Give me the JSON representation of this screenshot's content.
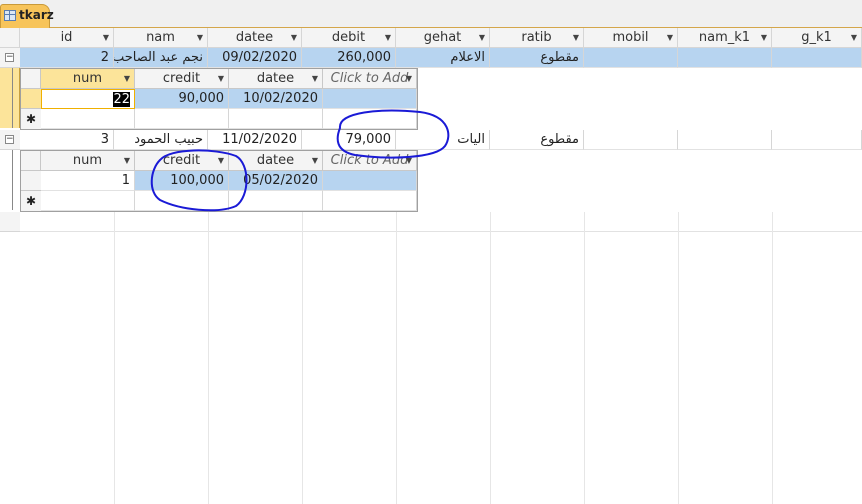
{
  "tab": {
    "label": "tkarz"
  },
  "columns": [
    "id",
    "nam",
    "datee",
    "debit",
    "gehat",
    "ratib",
    "mobil",
    "nam_k1",
    "g_k1"
  ],
  "records": [
    {
      "id": "2",
      "nam": "نجم عبد الصاحب",
      "datee": "09/02/2020",
      "debit": "260,000",
      "gehat": "الاعلام",
      "ratib": "مقطوع",
      "subform": {
        "headers": [
          "num",
          "credit",
          "datee",
          "Click to Add"
        ],
        "row": {
          "num": "22",
          "credit": "90,000",
          "datee": "10/02/2020"
        }
      }
    },
    {
      "id": "3",
      "nam": "حبيب الحمود",
      "datee": "11/02/2020",
      "debit": "79,000",
      "gehat": "اليات",
      "ratib": "مقطوع",
      "subform": {
        "headers": [
          "num",
          "credit",
          "datee",
          "Click to Add"
        ],
        "row": {
          "num": "1",
          "credit": "100,000",
          "datee": "05/02/2020"
        }
      }
    }
  ],
  "glyphs": {
    "expand": "⊟",
    "new_record": "✱",
    "dropdown": "▾"
  },
  "annotation_color": "#1a1ad6"
}
